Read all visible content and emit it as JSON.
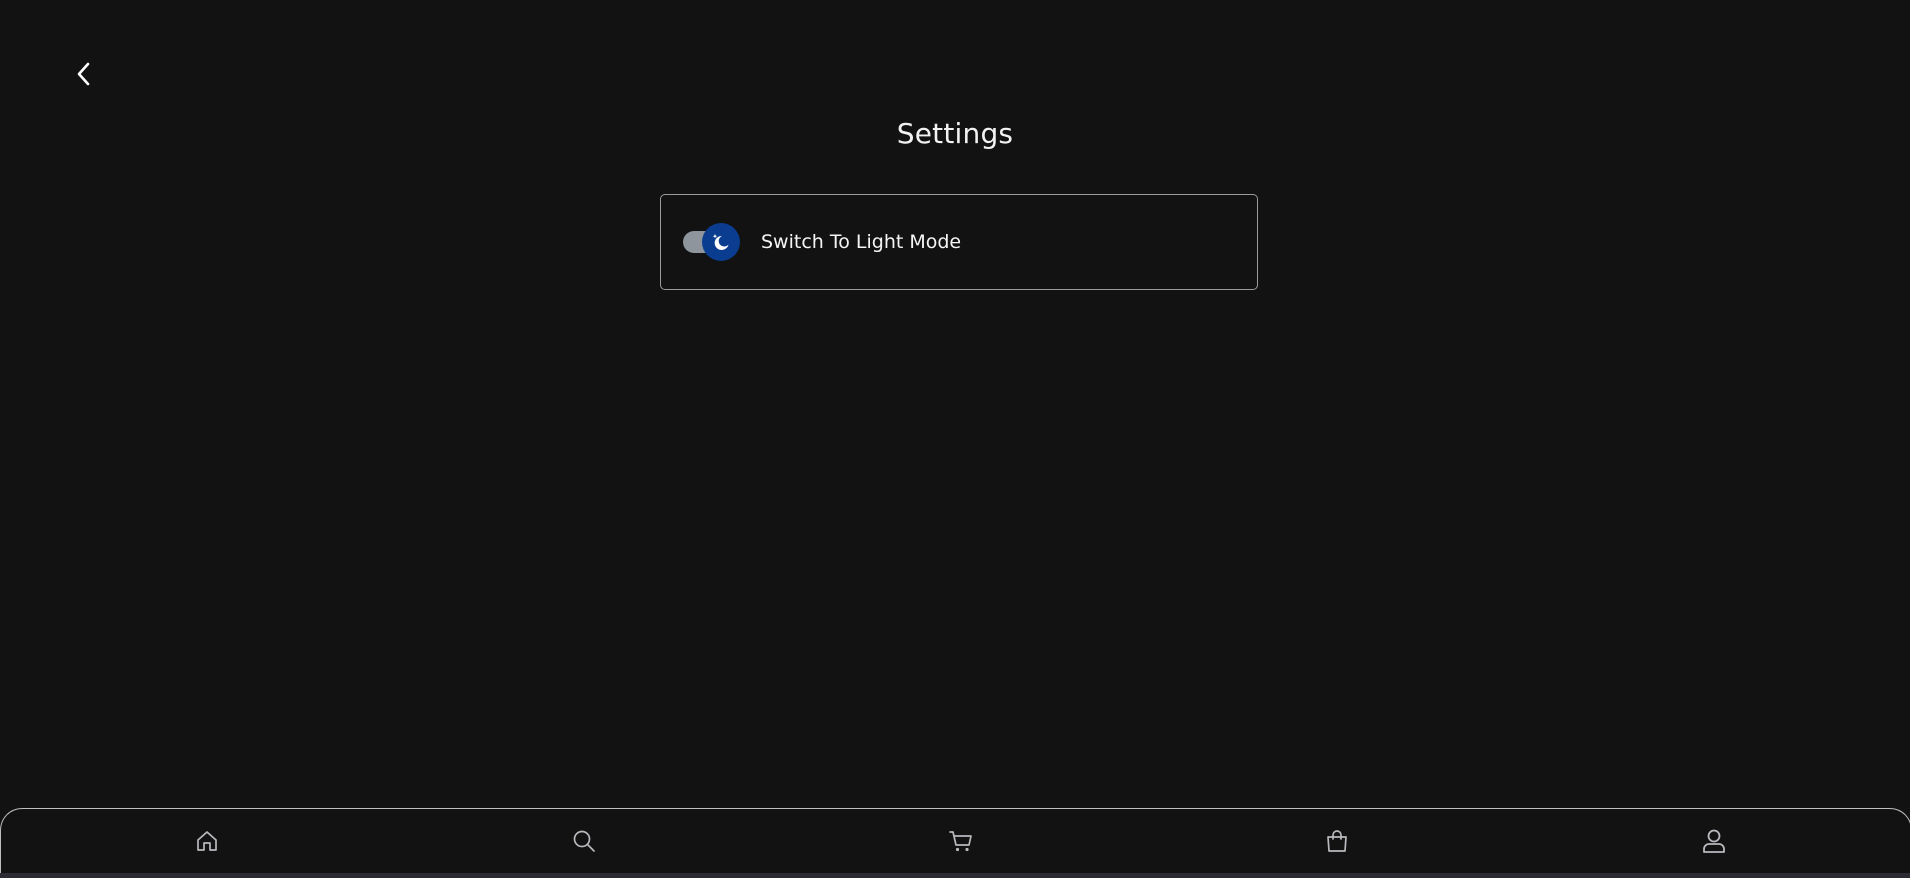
{
  "header": {
    "back_icon": "chevron-left-icon",
    "title": "Settings"
  },
  "settings": {
    "theme_toggle": {
      "label": "Switch To Light Mode",
      "state": "dark",
      "icon": "moon-icon"
    }
  },
  "bottom_nav": {
    "items": [
      {
        "icon": "home-icon"
      },
      {
        "icon": "search-icon"
      },
      {
        "icon": "cart-icon"
      },
      {
        "icon": "bag-icon"
      },
      {
        "icon": "user-icon"
      }
    ]
  },
  "colors": {
    "background": "#121213",
    "card_border": "#9a9a9f",
    "toggle_track": "#8e959d",
    "toggle_knob": "#0a3d8f",
    "text": "#ffffff",
    "nav_icon": "#b9b9be"
  }
}
